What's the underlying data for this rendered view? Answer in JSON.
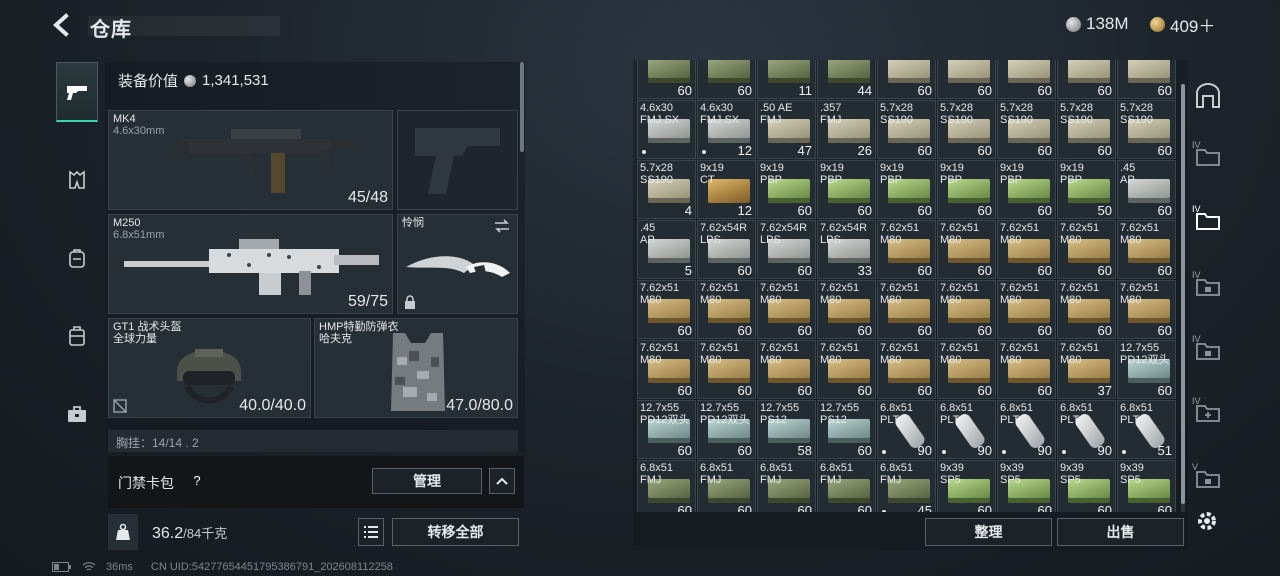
{
  "header": {
    "title": "仓库",
    "currency_silver": "138M",
    "currency_gold": "409＋"
  },
  "equipment": {
    "value_label": "装备价值",
    "value": "1,341,531",
    "primary": {
      "name": "MK4",
      "caliber": "4.6x30mm",
      "ammo": "45/48"
    },
    "secondary": {
      "name": "M250",
      "caliber": "6.8x51mm",
      "ammo": "59/75"
    },
    "melee": {
      "name": "怜悯"
    },
    "helmet": {
      "name": "GT1 战术头盔",
      "maker": "全球力量",
      "durability": "40.0/40.0"
    },
    "armor": {
      "name": "HMP特勤防弹衣",
      "maker": "哈夫克",
      "durability": "47.0/80.0"
    },
    "chest_partial": "胸挂：14/14 . 2"
  },
  "keycard": {
    "label": "门禁卡包",
    "help": "?",
    "manage_label": "管理"
  },
  "inventory": {
    "weight": "36.2",
    "capacity": "/84千克",
    "transfer_label": "转移全部"
  },
  "storage": {
    "sort_label": "整理",
    "sell_label": "出售"
  },
  "footer": {
    "ping": "36ms",
    "uid": "CN UID:5427765445179538679​1_202608112258"
  },
  "grid": [
    [
      {
        "l": "",
        "c": "60",
        "a": "olive"
      },
      {
        "l": "",
        "c": "60",
        "a": "olive"
      },
      {
        "l": "",
        "c": "11",
        "a": "olive"
      },
      {
        "l": "",
        "c": "44",
        "a": "olive"
      },
      {
        "l": "",
        "c": "60",
        "a": "beige"
      },
      {
        "l": "",
        "c": "60",
        "a": "beige"
      },
      {
        "l": "",
        "c": "60",
        "a": "beige"
      },
      {
        "l": "",
        "c": "60",
        "a": "beige"
      },
      {
        "l": "",
        "c": "60",
        "a": "beige"
      }
    ],
    [
      {
        "l": "4.6x30\nFMJ SX",
        "c": "",
        "a": "grey",
        "d": true
      },
      {
        "l": "4.6x30\nFMJ SX",
        "c": "12",
        "a": "grey",
        "d": true
      },
      {
        "l": ".50 AE\nFMJ",
        "c": "47",
        "a": "beige"
      },
      {
        "l": ".357\nFMJ",
        "c": "26",
        "a": "beige"
      },
      {
        "l": "5.7x28\nSS190",
        "c": "60",
        "a": "beige"
      },
      {
        "l": "5.7x28\nSS190",
        "c": "60",
        "a": "beige"
      },
      {
        "l": "5.7x28\nSS190",
        "c": "60",
        "a": "beige"
      },
      {
        "l": "5.7x28\nSS190",
        "c": "60",
        "a": "beige"
      },
      {
        "l": "5.7x28\nSS190",
        "c": "60",
        "a": "beige"
      }
    ],
    [
      {
        "l": "5.7x28\nSS190",
        "c": "4",
        "a": "beige"
      },
      {
        "l": "9x19\nCT",
        "c": "12",
        "a": "brass"
      },
      {
        "l": "9x19\nPBP",
        "c": "60",
        "a": "green"
      },
      {
        "l": "9x19\nPBP",
        "c": "60",
        "a": "green"
      },
      {
        "l": "9x19\nPBP",
        "c": "60",
        "a": "green"
      },
      {
        "l": "9x19\nPBP",
        "c": "60",
        "a": "green"
      },
      {
        "l": "9x19\nPBP",
        "c": "60",
        "a": "green"
      },
      {
        "l": "9x19\nPBP",
        "c": "50",
        "a": "green"
      },
      {
        "l": ".45\nAP",
        "c": "60",
        "a": "grey"
      }
    ],
    [
      {
        "l": ".45\nAP",
        "c": "5",
        "a": "grey"
      },
      {
        "l": "7.62x54R\nLPS",
        "c": "60",
        "a": "grey"
      },
      {
        "l": "7.62x54R\nLPS",
        "c": "60",
        "a": "grey"
      },
      {
        "l": "7.62x54R\nLPS",
        "c": "33",
        "a": "grey"
      },
      {
        "l": "7.62x51\nM80",
        "c": "60",
        "a": "tan"
      },
      {
        "l": "7.62x51\nM80",
        "c": "60",
        "a": "tan"
      },
      {
        "l": "7.62x51\nM80",
        "c": "60",
        "a": "tan"
      },
      {
        "l": "7.62x51\nM80",
        "c": "60",
        "a": "tan"
      },
      {
        "l": "7.62x51\nM80",
        "c": "60",
        "a": "tan"
      }
    ],
    [
      {
        "l": "7.62x51\nM80",
        "c": "60",
        "a": "tan"
      },
      {
        "l": "7.62x51\nM80",
        "c": "60",
        "a": "tan"
      },
      {
        "l": "7.62x51\nM80",
        "c": "60",
        "a": "tan"
      },
      {
        "l": "7.62x51\nM80",
        "c": "60",
        "a": "tan"
      },
      {
        "l": "7.62x51\nM80",
        "c": "60",
        "a": "tan"
      },
      {
        "l": "7.62x51\nM80",
        "c": "60",
        "a": "tan"
      },
      {
        "l": "7.62x51\nM80",
        "c": "60",
        "a": "tan"
      },
      {
        "l": "7.62x51\nM80",
        "c": "60",
        "a": "tan"
      },
      {
        "l": "7.62x51\nM80",
        "c": "60",
        "a": "tan"
      }
    ],
    [
      {
        "l": "7.62x51\nM80",
        "c": "60",
        "a": "tan"
      },
      {
        "l": "7.62x51\nM80",
        "c": "60",
        "a": "tan"
      },
      {
        "l": "7.62x51\nM80",
        "c": "60",
        "a": "tan"
      },
      {
        "l": "7.62x51\nM80",
        "c": "60",
        "a": "tan"
      },
      {
        "l": "7.62x51\nM80",
        "c": "60",
        "a": "tan"
      },
      {
        "l": "7.62x51\nM80",
        "c": "60",
        "a": "tan"
      },
      {
        "l": "7.62x51\nM80",
        "c": "60",
        "a": "tan"
      },
      {
        "l": "7.62x51\nM80",
        "c": "37",
        "a": "tan"
      },
      {
        "l": "12.7x55\nPD12双头",
        "c": "60",
        "a": "teal"
      }
    ],
    [
      {
        "l": "12.7x55\nPD12双头",
        "c": "60",
        "a": "teal"
      },
      {
        "l": "12.7x55\nPD12双头",
        "c": "60",
        "a": "teal"
      },
      {
        "l": "12.7x55\nPS12",
        "c": "58",
        "a": "teal"
      },
      {
        "l": "12.7x55\nPS12",
        "c": "60",
        "a": "teal"
      },
      {
        "l": "6.8x51\nPLT",
        "c": "90",
        "a": "silver",
        "d": true
      },
      {
        "l": "6.8x51\nPLT",
        "c": "90",
        "a": "silver",
        "d": true
      },
      {
        "l": "6.8x51\nPLT",
        "c": "90",
        "a": "silver",
        "d": true
      },
      {
        "l": "6.8x51\nPLT",
        "c": "90",
        "a": "silver",
        "d": true
      },
      {
        "l": "6.8x51\nPLT",
        "c": "51",
        "a": "silver",
        "d": true
      }
    ],
    [
      {
        "l": "6.8x51\nFMJ",
        "c": "60",
        "a": "olive"
      },
      {
        "l": "6.8x51\nFMJ",
        "c": "60",
        "a": "olive"
      },
      {
        "l": "6.8x51\nFMJ",
        "c": "60",
        "a": "olive"
      },
      {
        "l": "6.8x51\nFMJ",
        "c": "60",
        "a": "olive"
      },
      {
        "l": "6.8x51\nFMJ",
        "c": "45",
        "a": "olive",
        "d": true
      },
      {
        "l": "9x39\nSP5",
        "c": "60",
        "a": "green"
      },
      {
        "l": "9x39\nSP5",
        "c": "60",
        "a": "green"
      },
      {
        "l": "9x39\nSP5",
        "c": "60",
        "a": "green"
      },
      {
        "l": "9x39\nSP5",
        "c": "60",
        "a": "green"
      }
    ]
  ]
}
